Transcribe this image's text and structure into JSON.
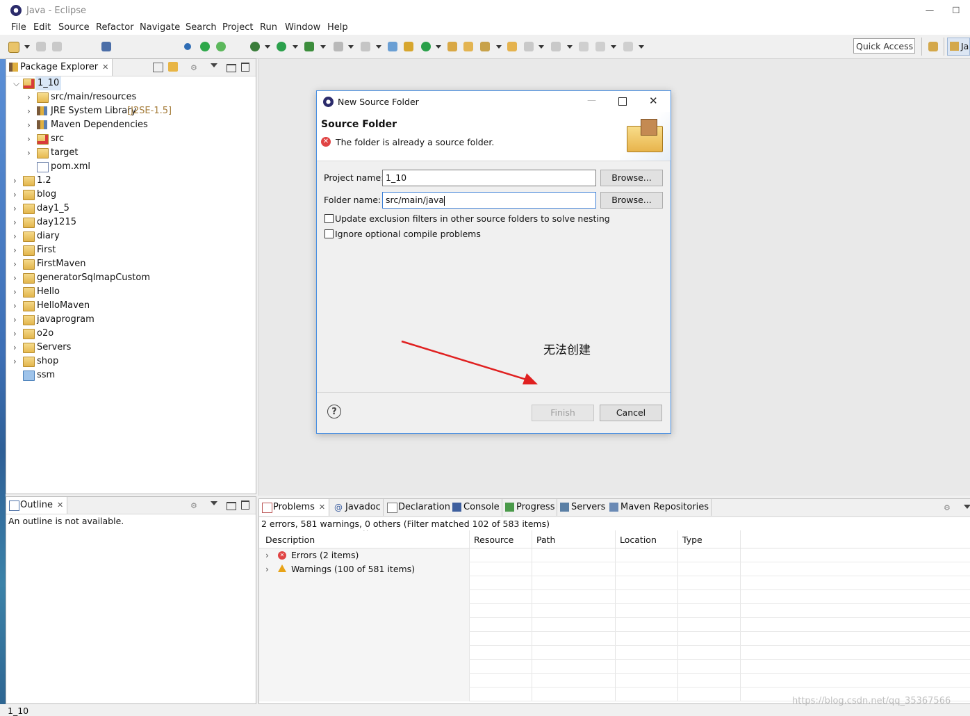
{
  "window": {
    "title": "Java - Eclipse",
    "minimize": "—",
    "maximize": "☐"
  },
  "menu": [
    "File",
    "Edit",
    "Source",
    "Refactor",
    "Navigate",
    "Search",
    "Project",
    "Run",
    "Window",
    "Help"
  ],
  "toolbar": {
    "quick_access": "Quick Access",
    "perspective_label": "Ja"
  },
  "package_explorer": {
    "tab_label": "Package Explorer",
    "items": [
      {
        "label": "1_10",
        "level": 0,
        "expanded": true,
        "selected": true,
        "icon": "maven-project-error-icon"
      },
      {
        "label": "src/main/resources",
        "level": 1,
        "icon": "package-folder-icon"
      },
      {
        "label": "JRE System Library",
        "suffix": "[J2SE-1.5]",
        "level": 1,
        "icon": "library-icon"
      },
      {
        "label": "Maven Dependencies",
        "level": 1,
        "icon": "library-icon"
      },
      {
        "label": "src",
        "level": 1,
        "icon": "folder-error-icon"
      },
      {
        "label": "target",
        "level": 1,
        "icon": "folder-icon"
      },
      {
        "label": "pom.xml",
        "level": 1,
        "icon": "xml-file-icon",
        "leaf": true
      },
      {
        "label": "1.2",
        "level": 0,
        "icon": "project-icon"
      },
      {
        "label": "blog",
        "level": 0,
        "icon": "maven-project-icon"
      },
      {
        "label": "day1_5",
        "level": 0,
        "icon": "project-icon"
      },
      {
        "label": "day1215",
        "level": 0,
        "icon": "project-icon"
      },
      {
        "label": "diary",
        "level": 0,
        "icon": "project-icon"
      },
      {
        "label": "First",
        "level": 0,
        "icon": "maven-project-icon"
      },
      {
        "label": "FirstMaven",
        "level": 0,
        "icon": "maven-project-icon"
      },
      {
        "label": "generatorSqlmapCustom",
        "level": 0,
        "icon": "project-icon"
      },
      {
        "label": "Hello",
        "level": 0,
        "icon": "project-icon"
      },
      {
        "label": "HelloMaven",
        "level": 0,
        "icon": "maven-project-icon"
      },
      {
        "label": "javaprogram",
        "level": 0,
        "icon": "project-icon"
      },
      {
        "label": "o2o",
        "level": 0,
        "icon": "maven-project-icon"
      },
      {
        "label": "Servers",
        "level": 0,
        "icon": "folder-icon"
      },
      {
        "label": "shop",
        "level": 0,
        "icon": "project-icon"
      },
      {
        "label": "ssm",
        "level": 0,
        "icon": "closed-project-icon",
        "leaf": true
      }
    ]
  },
  "outline": {
    "tab_label": "Outline",
    "message": "An outline is not available."
  },
  "dialog": {
    "title": "New Source Folder",
    "heading": "Source Folder",
    "error_message": "The folder is already a source folder.",
    "project_label": "Project name:",
    "project_value": "1_10",
    "folder_label": "Folder name:",
    "folder_value": "src/main/java",
    "browse": "Browse...",
    "option1": "Update exclusion filters in other source folders to solve nesting",
    "option2": "Ignore optional compile problems",
    "finish": "Finish",
    "cancel": "Cancel",
    "annotation": "无法创建"
  },
  "bottom_tabs": [
    "Problems",
    "Javadoc",
    "Declaration",
    "Console",
    "Progress",
    "Servers",
    "Maven Repositories"
  ],
  "problems": {
    "summary": "2 errors, 581 warnings, 0 others (Filter matched 102 of 583 items)",
    "columns": [
      "Description",
      "Resource",
      "Path",
      "Location",
      "Type"
    ],
    "rows": [
      {
        "label": "Errors (2 items)",
        "kind": "error"
      },
      {
        "label": "Warnings (100 of 581 items)",
        "kind": "warning"
      }
    ]
  },
  "status_bar": {
    "text": "1_10"
  },
  "watermark": "https://blog.csdn.net/qq_35367566",
  "colors": {
    "selection": "#d9e7f7",
    "dialog_border": "#4a90e2",
    "error": "#e04343",
    "warning": "#e8a317",
    "arrow": "#e02020"
  }
}
